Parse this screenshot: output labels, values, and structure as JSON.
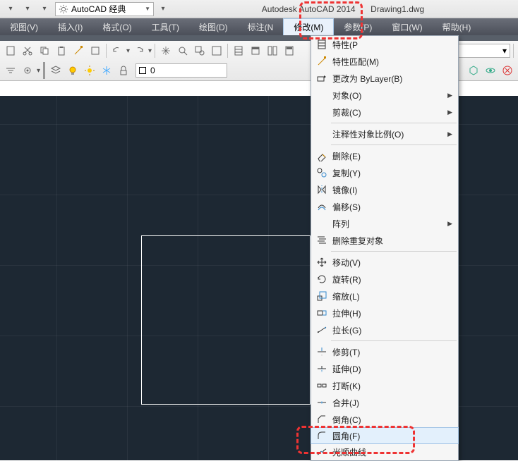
{
  "titlebar": {
    "workspace_label": "AutoCAD 经典",
    "app_title": "Autodesk AutoCAD 2014",
    "doc_title": "Drawing1.dwg"
  },
  "menubar": {
    "items": [
      "视图(V)",
      "插入(I)",
      "格式(O)",
      "工具(T)",
      "绘图(D)",
      "标注(N",
      "修改(M)",
      "参数(P)",
      "窗口(W)",
      "帮助(H)"
    ]
  },
  "layer": {
    "current": "0"
  },
  "dropdown": {
    "items": [
      {
        "label": "特性(P",
        "icon": "properties-icon",
        "sub": false
      },
      {
        "label": "特性匹配(M)",
        "icon": "match-prop-icon",
        "sub": false
      },
      {
        "label": "更改为 ByLayer(B)",
        "icon": "bylayer-icon",
        "sub": false
      },
      {
        "label": "对象(O)",
        "icon": "",
        "sub": true
      },
      {
        "label": "剪裁(C)",
        "icon": "",
        "sub": true
      },
      {
        "sep": true
      },
      {
        "label": "注释性对象比例(O)",
        "icon": "",
        "sub": true
      },
      {
        "sep": true
      },
      {
        "label": "删除(E)",
        "icon": "erase-icon",
        "sub": false
      },
      {
        "label": "复制(Y)",
        "icon": "copy-icon",
        "sub": false
      },
      {
        "label": "镜像(I)",
        "icon": "mirror-icon",
        "sub": false
      },
      {
        "label": "偏移(S)",
        "icon": "offset-icon",
        "sub": false
      },
      {
        "label": "阵列",
        "icon": "",
        "sub": true
      },
      {
        "label": "删除重复对象",
        "icon": "overkill-icon",
        "sub": false
      },
      {
        "sep": true
      },
      {
        "label": "移动(V)",
        "icon": "move-icon",
        "sub": false
      },
      {
        "label": "旋转(R)",
        "icon": "rotate-icon",
        "sub": false
      },
      {
        "label": "缩放(L)",
        "icon": "scale-icon",
        "sub": false
      },
      {
        "label": "拉伸(H)",
        "icon": "stretch-icon",
        "sub": false
      },
      {
        "label": "拉长(G)",
        "icon": "lengthen-icon",
        "sub": false
      },
      {
        "sep": true
      },
      {
        "label": "修剪(T)",
        "icon": "trim-icon",
        "sub": false
      },
      {
        "label": "延伸(D)",
        "icon": "extend-icon",
        "sub": false
      },
      {
        "label": "打断(K)",
        "icon": "break-icon",
        "sub": false
      },
      {
        "label": "合并(J)",
        "icon": "join-icon",
        "sub": false
      },
      {
        "label": "倒角(C)",
        "icon": "chamfer-icon",
        "sub": false
      },
      {
        "label": "圆角(F)",
        "icon": "fillet-icon",
        "sub": false,
        "hover": true
      },
      {
        "label": "光顺曲线",
        "icon": "blend-icon",
        "sub": false
      }
    ]
  }
}
